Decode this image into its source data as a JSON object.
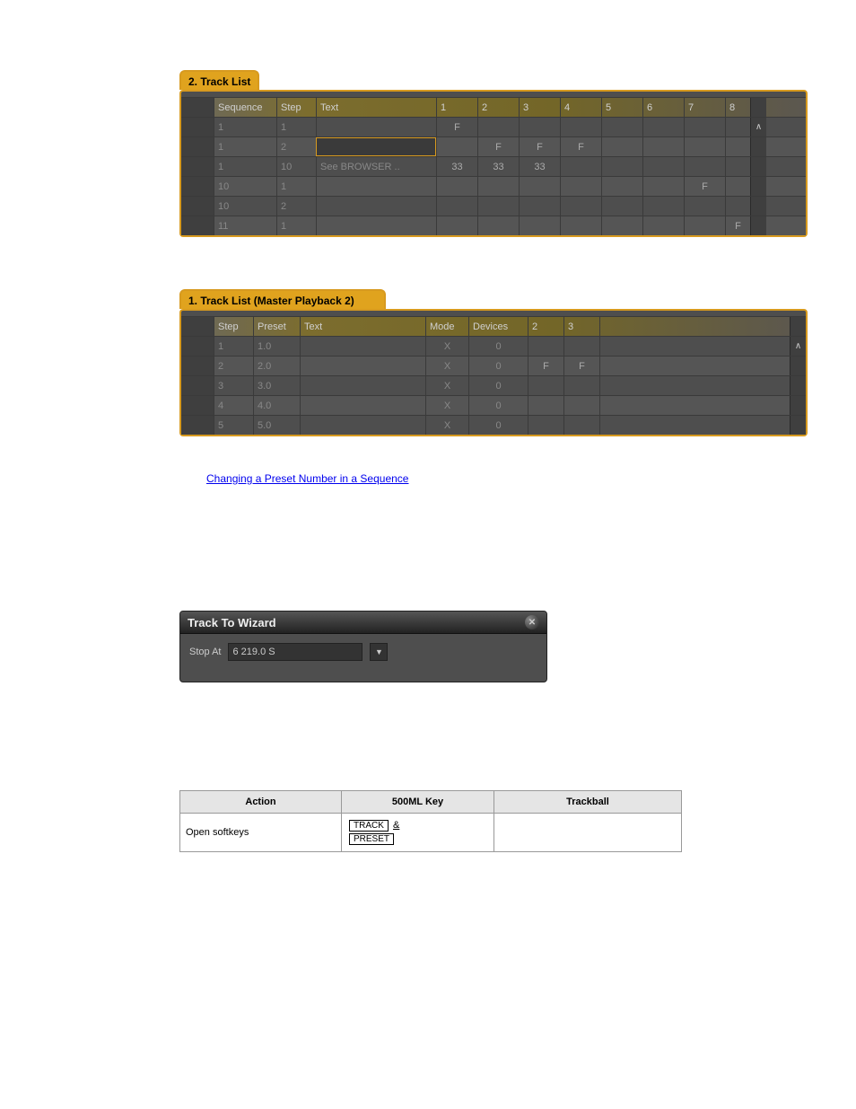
{
  "panel1": {
    "tab": "2. Track List",
    "headers": [
      "Sequence",
      "Step",
      "Text",
      "1",
      "2",
      "3",
      "4",
      "5",
      "6",
      "7",
      "8"
    ],
    "rows": [
      {
        "seq": "1",
        "step": "1",
        "text": "",
        "cols": [
          "F",
          "",
          "",
          "",
          "",
          "",
          "",
          ""
        ]
      },
      {
        "seq": "1",
        "step": "2",
        "text": "",
        "cols": [
          "",
          "F",
          "F",
          "F",
          "",
          "",
          "",
          ""
        ],
        "selected": true
      },
      {
        "seq": "1",
        "step": "10",
        "text": "See BROWSER ..",
        "cols": [
          "33",
          "33",
          "33",
          "",
          "",
          "",
          "",
          ""
        ]
      },
      {
        "seq": "10",
        "step": "1",
        "text": "",
        "cols": [
          "",
          "",
          "",
          "",
          "",
          "",
          "F",
          ""
        ]
      },
      {
        "seq": "10",
        "step": "2",
        "text": "",
        "cols": [
          "",
          "",
          "",
          "",
          "",
          "",
          "",
          ""
        ]
      },
      {
        "seq": "11",
        "step": "1",
        "text": "",
        "cols": [
          "",
          "",
          "",
          "",
          "",
          "",
          "",
          "F"
        ]
      }
    ]
  },
  "panel2": {
    "tab": "1. Track List (Master Playback 2)",
    "headers": [
      "Step",
      "Preset",
      "Text",
      "Mode",
      "Devices",
      "2",
      "3"
    ],
    "rows": [
      {
        "step": "1",
        "preset": "1.0",
        "text": "",
        "mode": "X",
        "devices": "0",
        "c2": "",
        "c3": ""
      },
      {
        "step": "2",
        "preset": "2.0",
        "text": "",
        "mode": "X",
        "devices": "0",
        "c2": "F",
        "c3": "F"
      },
      {
        "step": "3",
        "preset": "3.0",
        "text": "",
        "mode": "X",
        "devices": "0",
        "c2": "",
        "c3": ""
      },
      {
        "step": "4",
        "preset": "4.0",
        "text": "",
        "mode": "X",
        "devices": "0",
        "c2": "",
        "c3": ""
      },
      {
        "step": "5",
        "preset": "5.0",
        "text": "",
        "mode": "X",
        "devices": "0",
        "c2": "",
        "c3": ""
      }
    ]
  },
  "link1": "Changing a Preset Number in a Sequence",
  "wizard": {
    "title": "Track To Wizard",
    "stopAtLabel": "Stop At",
    "stopAtValue": "6   219.0 S"
  },
  "infotable": {
    "headers": [
      "Action",
      "500ML Key",
      "Trackball"
    ],
    "row1": {
      "action": "Open softkeys",
      "keys": [
        "TRACK",
        "&",
        "PRESET"
      ],
      "trackball": ""
    }
  }
}
